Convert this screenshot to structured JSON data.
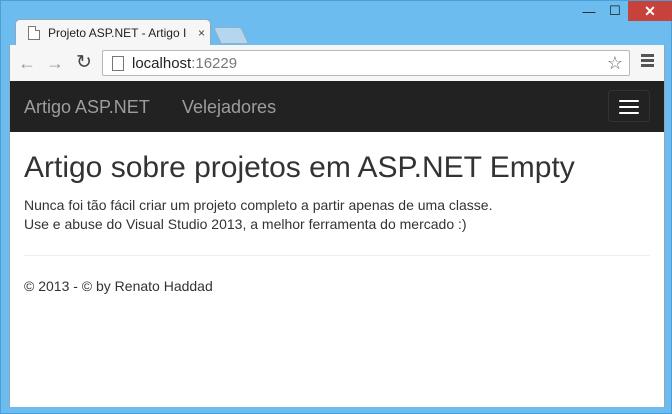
{
  "window": {
    "min_glyph": "—",
    "max_glyph": "☐",
    "close_glyph": "✕"
  },
  "browser": {
    "tab": {
      "title": "Projeto ASP.NET - Artigo I",
      "close_glyph": "×"
    },
    "nav": {
      "back_glyph": "←",
      "forward_glyph": "→",
      "reload_glyph": "↻"
    },
    "address": {
      "host": "localhost",
      "port": ":16229"
    },
    "star_glyph": "☆"
  },
  "site": {
    "brand": "Artigo ASP.NET",
    "nav_items": [
      "Velejadores"
    ],
    "heading": "Artigo sobre projetos em ASP.NET Empty",
    "paragraphs": [
      "Nunca foi tão fácil criar um projeto completo a partir apenas de uma classe.",
      "Use e abuse do Visual Studio 2013, a melhor ferramenta do mercado :)"
    ],
    "footer": "© 2013 - © by Renato Haddad"
  },
  "colors": {
    "frame": "#6cbcef",
    "close_button": "#c7423a",
    "navbar": "#222222",
    "navbar_text": "#9d9d9d"
  }
}
